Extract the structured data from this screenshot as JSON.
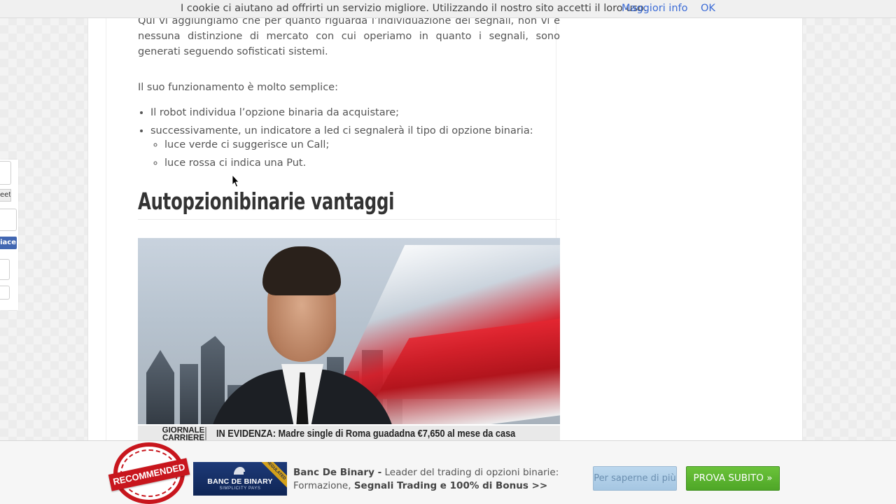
{
  "cookie_bar": {
    "text": "I cookie ci aiutano ad offrirti un servizio migliore. Utilizzando il nostro sito accetti il loro uso.",
    "more_link": "Maggiori info",
    "ok": "OK"
  },
  "article": {
    "paragraph_1": "Qui vi aggiungiamo che per quanto riguarda l’individuazione dei segnali, non vi è nessuna distinzione di mercato con cui operiamo in quanto i segnali, sono generati seguendo sofisticati sistemi.",
    "paragraph_2": "Il suo funzionamento è molto semplice:",
    "list": [
      "Il robot individua l’opzione binaria da acquistare;",
      "successivamente, un indicatore a led ci segnalerà il tipo di opzione binaria:"
    ],
    "sub_list": [
      "luce verde ci suggerisce un Call;",
      "luce rossa ci indica una Put."
    ],
    "heading": "Autopzionibinarie vantaggi",
    "video": {
      "ticker_brand": "GIORNALE CARRIERE",
      "ticker_headline": "IN EVIDENZA: Madre single di Roma guadadna €7,650 al mese da casa"
    }
  },
  "social": {
    "tweet_label": "eet",
    "like_label": "iace"
  },
  "ad": {
    "badge_text": "RECOMMENDED",
    "logo_name": "BANC DE BINARY",
    "logo_tagline": "SIMPLICITY PAYS",
    "logo_corner": "REGULATED",
    "brand": "Banc De Binary -",
    "desc_1": " Leader del trading di opzioni binarie:",
    "desc_2": "Formazione, ",
    "desc_3": "Segnali Trading e 100% di Bonus >>",
    "btn_more": "Per saperne di più",
    "btn_try": "PROVA SUBITO »"
  },
  "colors": {
    "link": "#3b6bd6",
    "ad_green": "#5cb531",
    "ad_red": "#c8161d",
    "logo_blue": "#1d3a78"
  }
}
